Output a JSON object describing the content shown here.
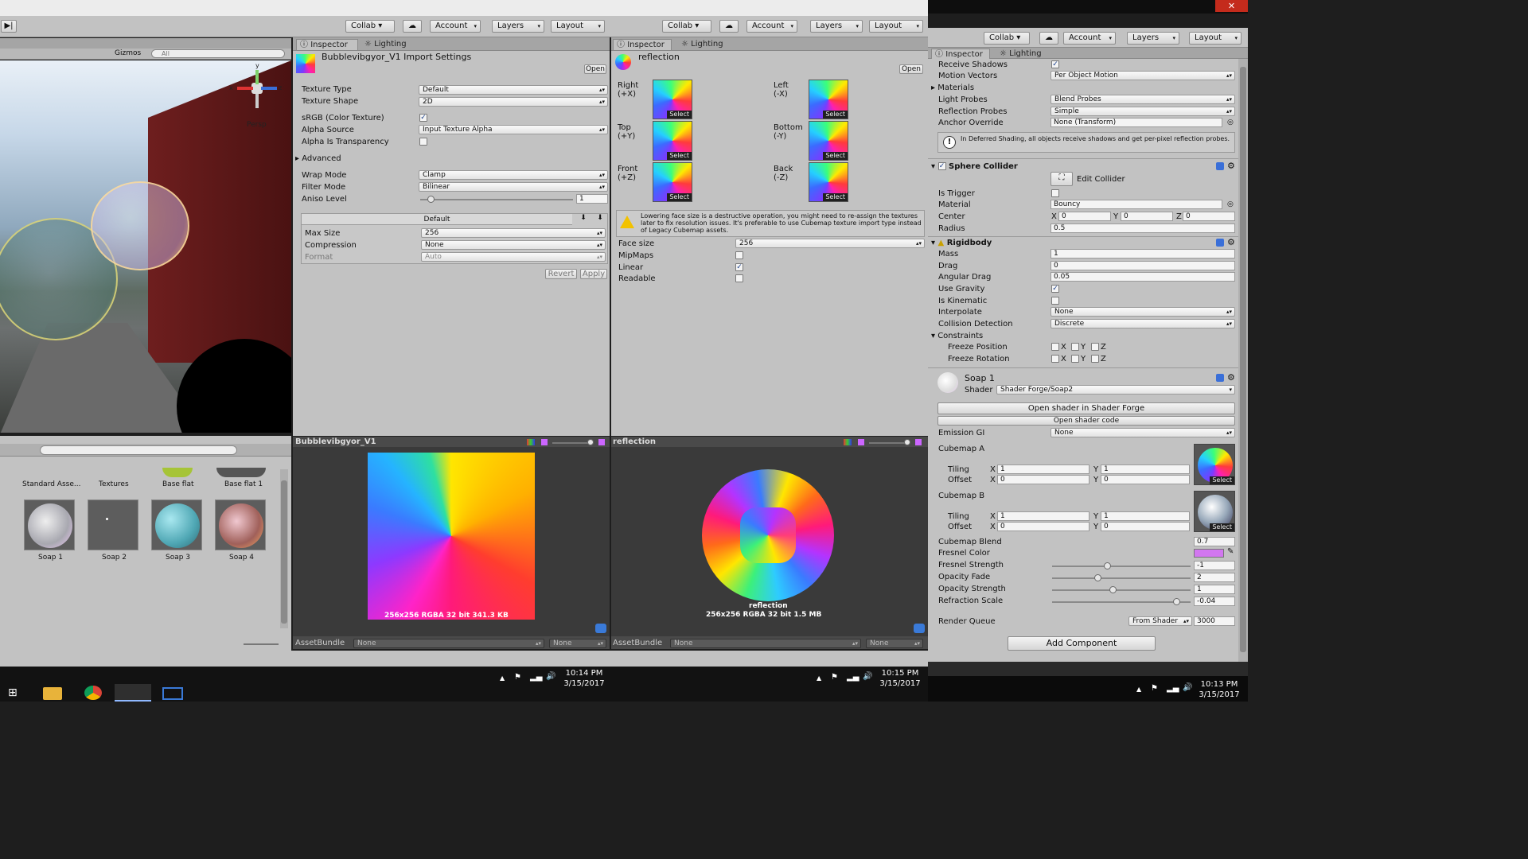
{
  "window": {
    "close_glyph": "✕"
  },
  "toolbar_left": {
    "collab": "Collab ▾",
    "account": "Account",
    "layers": "Layers",
    "layout": "Layout"
  },
  "toolbar_mid": {
    "collab": "Collab ▾",
    "account": "Account",
    "layers": "Layers",
    "layout": "Layout"
  },
  "toolbar_right": {
    "collab": "Collab ▾",
    "account": "Account",
    "layers": "Layers",
    "layout": "Layout"
  },
  "scene": {
    "gizmos": "Gizmos",
    "search_placeholder": "All",
    "persp": "Persp"
  },
  "project": {
    "items_top": [
      "Standard Asse...",
      "Textures",
      "Base flat",
      "Base flat 1"
    ],
    "items": [
      "Soap 1",
      "Soap 2",
      "Soap 3",
      "Soap 4"
    ]
  },
  "inspector1": {
    "tab_inspector": "Inspector",
    "tab_lighting": "Lighting",
    "title": "Bubblevibgyor_V1 Import Settings",
    "open": "Open",
    "texture_type_label": "Texture Type",
    "texture_type": "Default",
    "texture_shape_label": "Texture Shape",
    "texture_shape": "2D",
    "srgb_label": "sRGB (Color Texture)",
    "alpha_source_label": "Alpha Source",
    "alpha_source": "Input Texture Alpha",
    "alpha_transp_label": "Alpha Is Transparency",
    "advanced": "Advanced",
    "wrap_mode_label": "Wrap Mode",
    "wrap_mode": "Clamp",
    "filter_mode_label": "Filter Mode",
    "filter_mode": "Bilinear",
    "aniso_label": "Aniso Level",
    "aniso": "1",
    "platform_default": "Default",
    "max_size_label": "Max Size",
    "max_size": "256",
    "compression_label": "Compression",
    "compression": "None",
    "format_label": "Format",
    "format": "Auto",
    "revert": "Revert",
    "apply": "Apply",
    "preview_title": "Bubblevibgyor_V1",
    "preview_info": "256x256  RGBA 32 bit   341.3 KB",
    "assetbundle": "AssetBundle",
    "ab_none1": "None",
    "ab_none2": "None"
  },
  "inspector2": {
    "tab_inspector": "Inspector",
    "tab_lighting": "Lighting",
    "title": "reflection",
    "open": "Open",
    "faces": [
      {
        "name": "Right",
        "axis": "(+X)"
      },
      {
        "name": "Left",
        "axis": "(-X)"
      },
      {
        "name": "Top",
        "axis": "(+Y)"
      },
      {
        "name": "Bottom",
        "axis": "(-Y)"
      },
      {
        "name": "Front",
        "axis": "(+Z)"
      },
      {
        "name": "Back",
        "axis": "(-Z)"
      }
    ],
    "select": "Select",
    "warning": "Lowering face size is a destructive operation, you might need to re-assign the textures later to fix resolution issues. It's preferable to use Cubemap texture import type instead of Legacy Cubemap assets.",
    "face_size_label": "Face size",
    "face_size": "256",
    "mipmaps_label": "MipMaps",
    "linear_label": "Linear",
    "readable_label": "Readable",
    "preview_title": "reflection",
    "preview_name": "reflection",
    "preview_info": "256x256  RGBA 32 bit   1.5 MB",
    "assetbundle": "AssetBundle",
    "ab_none1": "None",
    "ab_none2": "None"
  },
  "inspector3": {
    "tab_inspector": "Inspector",
    "tab_lighting": "Lighting",
    "receive_shadows": "Receive Shadows",
    "motion_vectors": "Motion Vectors",
    "motion_vectors_val": "Per Object Motion",
    "materials": "Materials",
    "light_probes": "Light Probes",
    "light_probes_val": "Blend Probes",
    "reflection_probes": "Reflection Probes",
    "reflection_probes_val": "Simple",
    "anchor_override": "Anchor Override",
    "anchor_override_val": "None (Transform)",
    "deferred_info": "In Deferred Shading, all objects receive shadows and get per-pixel reflection probes.",
    "sphere_collider": "Sphere Collider",
    "edit_collider": "Edit Collider",
    "is_trigger": "Is Trigger",
    "material": "Material",
    "material_val": "Bouncy",
    "center": "Center",
    "center_x": "0",
    "center_y": "0",
    "center_z": "0",
    "radius": "Radius",
    "radius_val": "0.5",
    "rigidbody": "Rigidbody",
    "mass": "Mass",
    "mass_val": "1",
    "drag": "Drag",
    "drag_val": "0",
    "angular_drag": "Angular Drag",
    "angular_drag_val": "0.05",
    "use_gravity": "Use Gravity",
    "is_kinematic": "Is Kinematic",
    "interpolate": "Interpolate",
    "interpolate_val": "None",
    "collision_detection": "Collision Detection",
    "collision_detection_val": "Discrete",
    "constraints": "Constraints",
    "freeze_position": "Freeze Position",
    "freeze_rotation": "Freeze Rotation",
    "material_name": "Soap 1",
    "shader_label": "Shader",
    "shader_val": "Shader Forge/Soap2",
    "open_shader_forge": "Open shader in Shader Forge",
    "open_shader_code": "Open shader code",
    "emission_gi": "Emission GI",
    "emission_gi_val": "None",
    "cubemap_a": "Cubemap A",
    "cubemap_b": "Cubemap B",
    "tiling": "Tiling",
    "offset": "Offset",
    "tiling_x": "1",
    "tiling_y": "1",
    "offset_x": "0",
    "offset_y": "0",
    "cubemap_blend": "Cubemap Blend",
    "cubemap_blend_val": "0.7",
    "fresnel_color": "Fresnel Color",
    "fresnel_color_hex": "#d277f0",
    "fresnel_strength": "Fresnel Strength",
    "fresnel_strength_val": "-1",
    "opacity_fade": "Opacity Fade",
    "opacity_fade_val": "2",
    "opacity_strength": "Opacity Strength",
    "opacity_strength_val": "1",
    "refraction_scale": "Refraction Scale",
    "refraction_scale_val": "-0.04",
    "render_queue": "Render Queue",
    "render_queue_mode": "From Shader",
    "render_queue_val": "3000",
    "add_component": "Add Component"
  },
  "taskbar": {
    "time1": "10:14 PM",
    "date1": "3/15/2017",
    "time2": "10:15 PM",
    "date2": "3/15/2017",
    "time3": "10:13 PM",
    "date3": "3/15/2017"
  },
  "axes": {
    "x": "x",
    "y": "y",
    "z": "z"
  }
}
